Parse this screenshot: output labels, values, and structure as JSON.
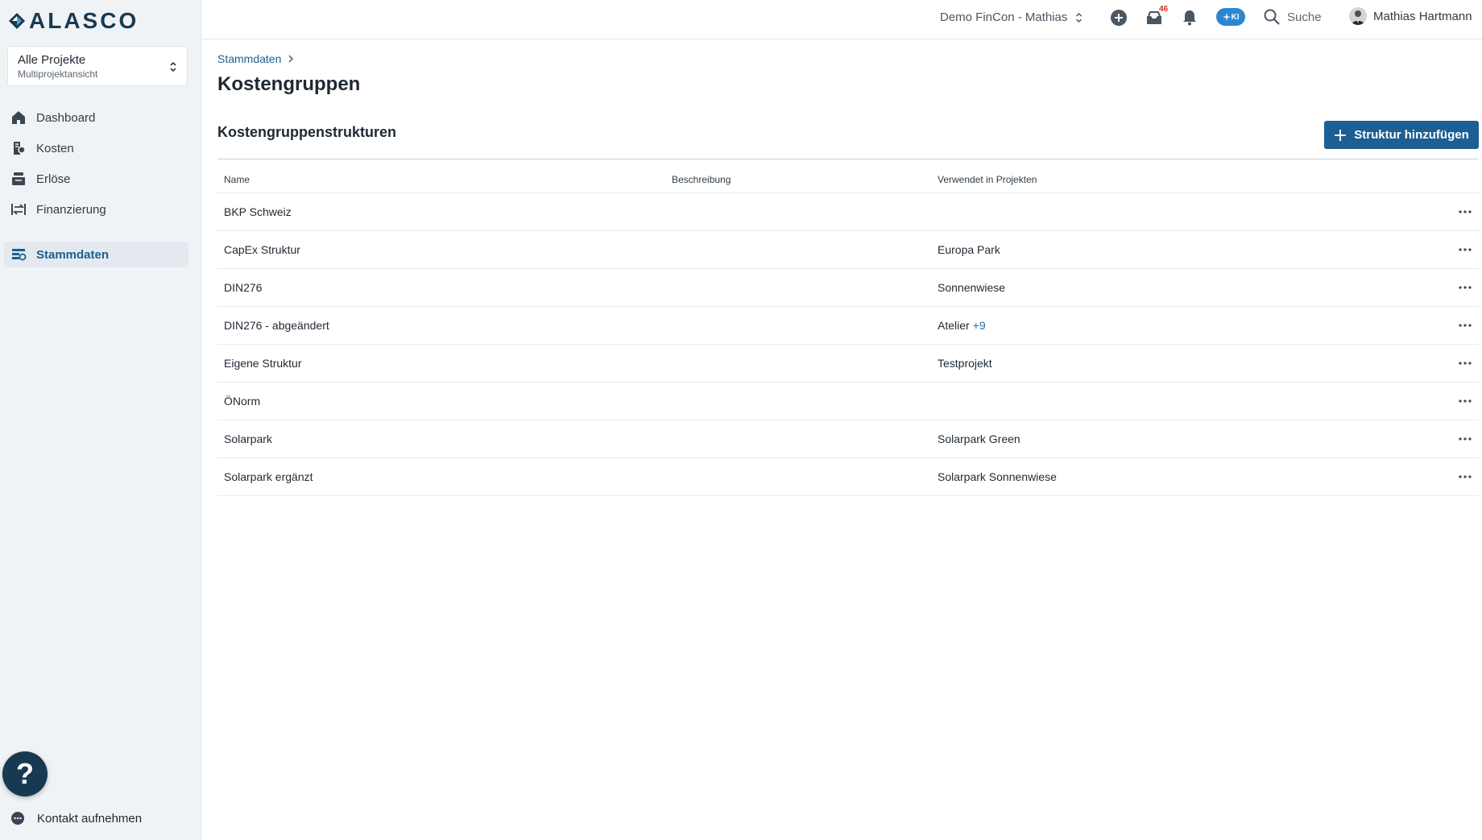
{
  "app": {
    "logo_text": "ALASCO"
  },
  "project_select": {
    "title": "Alle Projekte",
    "subtitle": "Multiprojektansicht"
  },
  "sidebar": {
    "items": [
      {
        "label": "Dashboard",
        "icon": "home-icon"
      },
      {
        "label": "Kosten",
        "icon": "cost-icon"
      },
      {
        "label": "Erlöse",
        "icon": "revenue-icon"
      },
      {
        "label": "Finanzierung",
        "icon": "financing-icon"
      },
      {
        "label": "Stammdaten",
        "icon": "master-data-icon",
        "active": true
      }
    ],
    "contact_label": "Kontakt aufnehmen",
    "help_label": "?"
  },
  "topbar": {
    "org": "Demo FinCon - Mathias",
    "inbox_badge": "46",
    "ki_label": "KI",
    "search_label": "Suche",
    "user_name": "Mathias Hartmann"
  },
  "breadcrumb": {
    "root": "Stammdaten"
  },
  "page": {
    "title": "Kostengruppen",
    "section_title": "Kostengruppenstrukturen",
    "add_button": "Struktur hinzufügen"
  },
  "table": {
    "headers": {
      "name": "Name",
      "description": "Beschreibung",
      "projects": "Verwendet in Projekten"
    },
    "rows": [
      {
        "name": "BKP Schweiz",
        "description": "",
        "projects": "",
        "more": ""
      },
      {
        "name": "CapEx Struktur",
        "description": "",
        "projects": "Europa Park",
        "more": ""
      },
      {
        "name": "DIN276",
        "description": "",
        "projects": "Sonnenwiese",
        "more": ""
      },
      {
        "name": "DIN276 - abgeändert",
        "description": "",
        "projects": "Atelier",
        "more": "+9"
      },
      {
        "name": "Eigene Struktur",
        "description": "",
        "projects": "Testprojekt",
        "more": ""
      },
      {
        "name": "ÖNorm",
        "description": "",
        "projects": "",
        "more": ""
      },
      {
        "name": "Solarpark",
        "description": "",
        "projects": "Solarpark Green",
        "more": ""
      },
      {
        "name": "Solarpark ergänzt",
        "description": "",
        "projects": "Solarpark Sonnenwiese",
        "more": ""
      }
    ]
  },
  "colors": {
    "brand": "#173a52",
    "accent": "#1d5f93",
    "link": "#1a5f8f",
    "badge": "#d93025",
    "ki": "#2a86cf"
  }
}
